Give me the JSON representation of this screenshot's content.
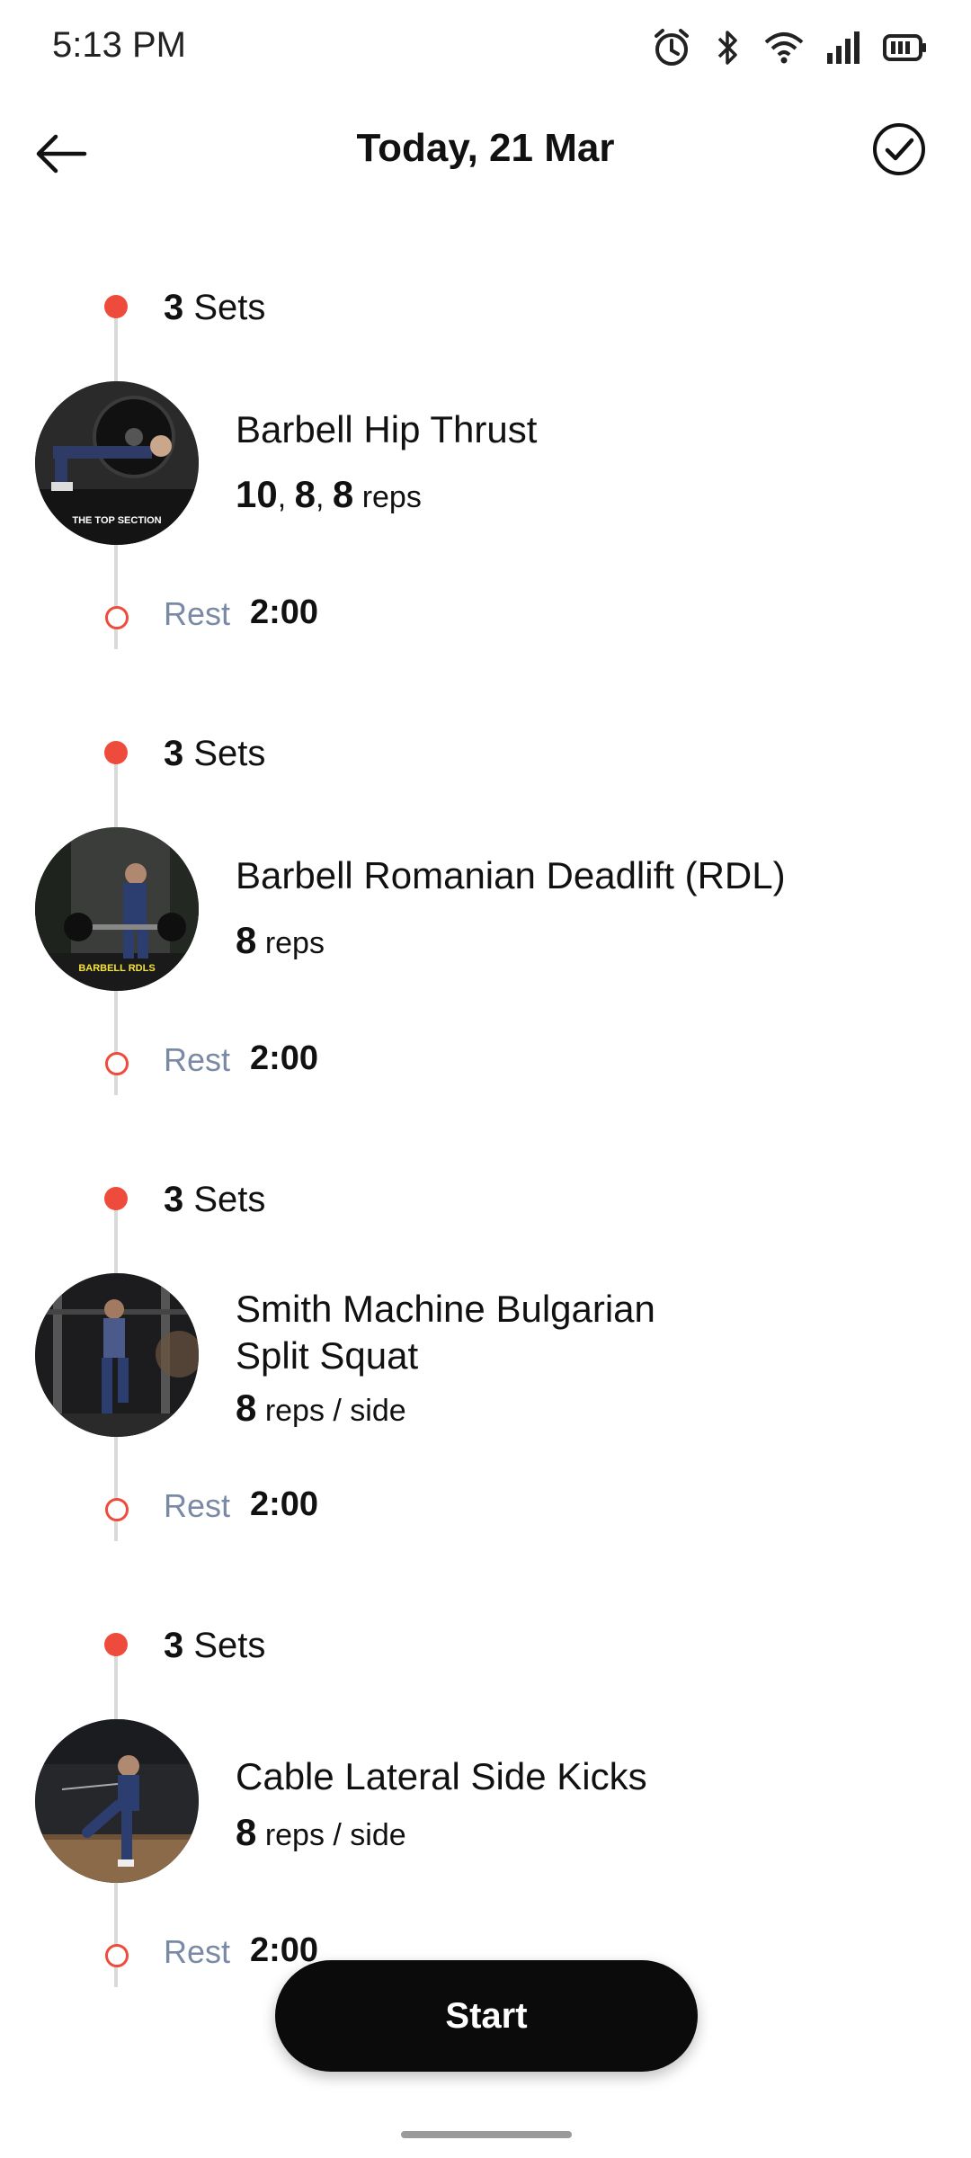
{
  "status_bar": {
    "time": "5:13 PM",
    "icons": [
      "alarm-icon",
      "bluetooth-icon",
      "wifi-icon",
      "signal-icon",
      "battery-icon"
    ]
  },
  "header": {
    "title": "Today, 21 Mar",
    "back_icon": "arrow-left-icon",
    "done_icon": "check-circle-icon"
  },
  "workout": [
    {
      "sets_count": "3",
      "sets_word": "Sets",
      "name_line1": "Barbell Hip Thrust",
      "name_line2": "",
      "reps_parts": [
        "10",
        ", ",
        "8",
        ", ",
        "8"
      ],
      "reps_unit": "reps",
      "thumb_caption": "THE TOP SECTION",
      "rest_label": "Rest",
      "rest_time": "2:00"
    },
    {
      "sets_count": "3",
      "sets_word": "Sets",
      "name_line1": "Barbell Romanian Deadlift (RDL)",
      "name_line2": "",
      "reps_parts": [
        "8"
      ],
      "reps_unit": "reps",
      "thumb_caption": "BARBELL RDLS",
      "rest_label": "Rest",
      "rest_time": "2:00"
    },
    {
      "sets_count": "3",
      "sets_word": "Sets",
      "name_line1": "Smith Machine Bulgarian",
      "name_line2": "Split Squat",
      "reps_parts": [
        "8"
      ],
      "reps_unit": "reps / side",
      "thumb_caption": "",
      "rest_label": "Rest",
      "rest_time": "2:00"
    },
    {
      "sets_count": "3",
      "sets_word": "Sets",
      "name_line1": "Cable Lateral Side Kicks",
      "name_line2": "",
      "reps_parts": [
        "8"
      ],
      "reps_unit": "reps / side",
      "thumb_caption": "",
      "rest_label": "Rest",
      "rest_time": "2:00"
    }
  ],
  "start_button": {
    "label": "Start"
  },
  "colors": {
    "accent": "#ee4b3c",
    "rail": "#d9d9d9",
    "rest_label": "#7a8aa5",
    "button": "#0b0b0b"
  }
}
